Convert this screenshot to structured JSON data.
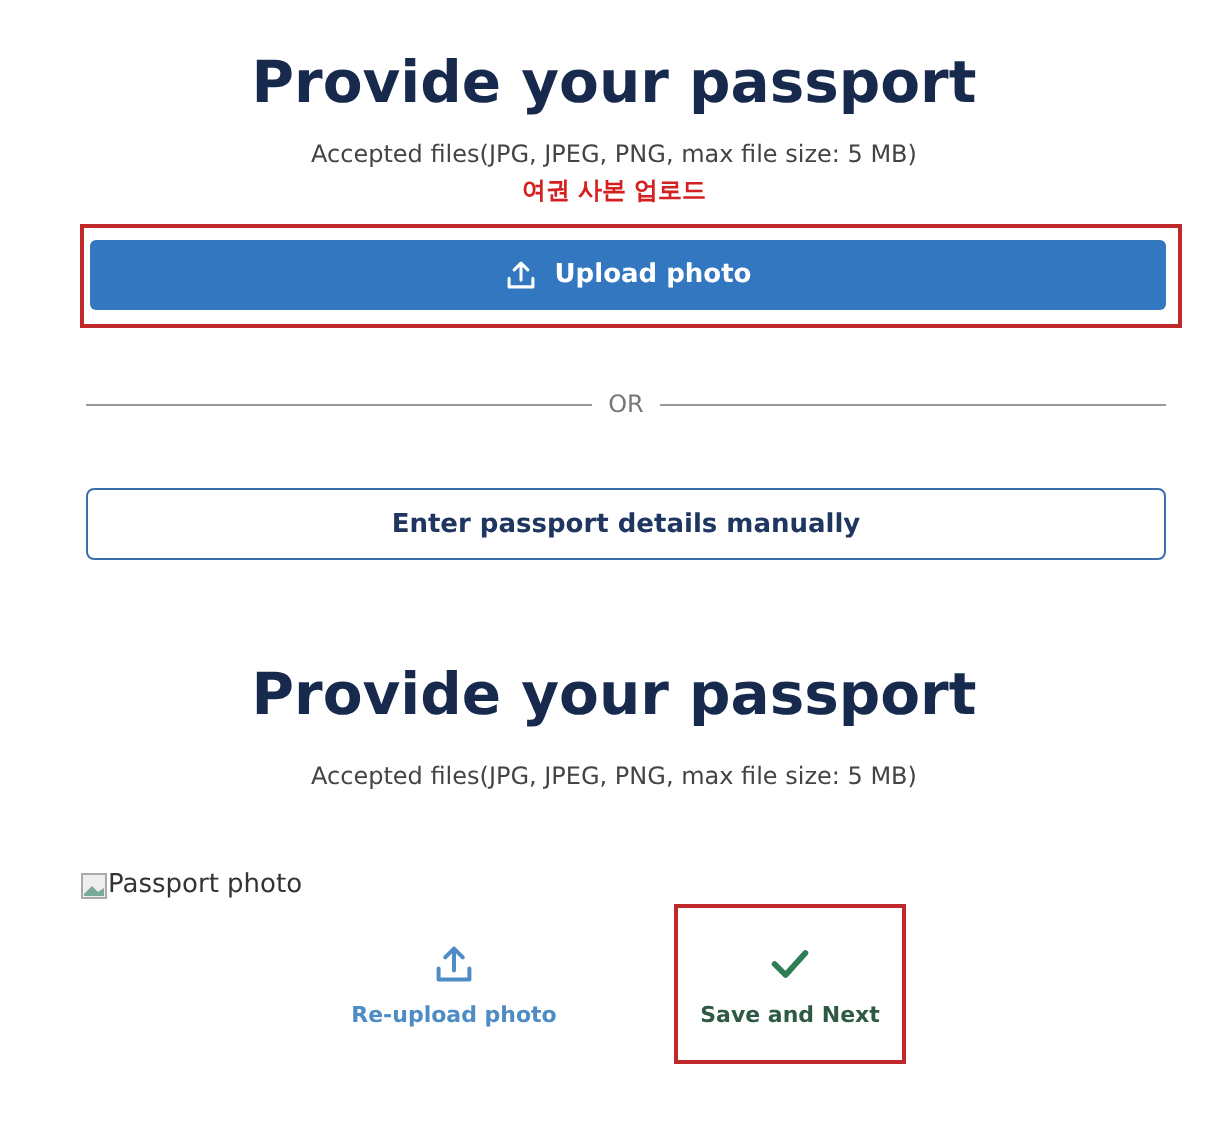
{
  "upload_step": {
    "title": "Provide your passport",
    "hint": "Accepted files(JPG, JPEG, PNG, max file size: 5 MB)",
    "note": "여권 사본 업로드",
    "upload_button": {
      "label": "Upload photo",
      "highlighted": true
    },
    "divider": "OR",
    "manual_button": {
      "label": "Enter passport details manually"
    }
  },
  "review_step": {
    "title": "Provide your passport",
    "hint": "Accepted files(JPG, JPEG, PNG, max file size: 5 MB)",
    "image_alt": "Passport photo",
    "actions": [
      {
        "kind": "reupload",
        "label": "Re-upload photo",
        "highlighted": false
      },
      {
        "kind": "save",
        "label": "Save and Next",
        "highlighted": true
      }
    ]
  }
}
